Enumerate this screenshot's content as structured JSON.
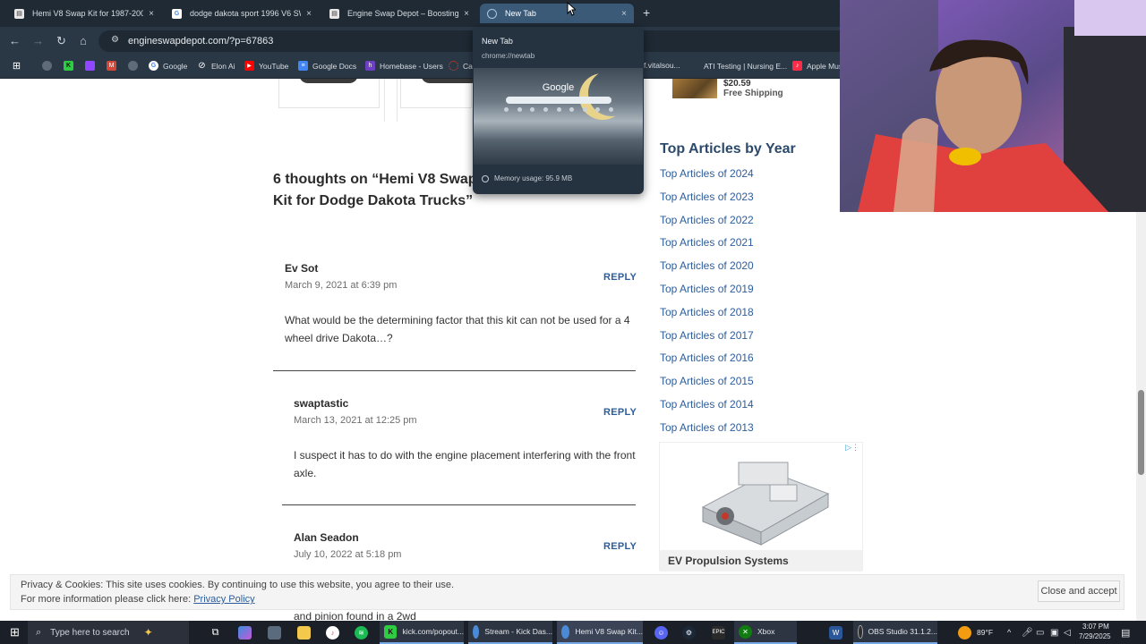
{
  "browser": {
    "tabs": [
      {
        "label": "Hemi V8 Swap Kit for 1987-2004 D",
        "favicon": "page-icon",
        "color": "#e8e8e8",
        "active": false
      },
      {
        "label": "dodge dakota sport 1996 V6 SWA",
        "favicon": "google-icon",
        "color": "#4285f4",
        "active": false
      },
      {
        "label": "Engine Swap Depot – Boosting Pe",
        "favicon": "page-icon",
        "color": "#e8e8e8",
        "active": false
      },
      {
        "label": "New Tab",
        "favicon": "chrome-icon",
        "color": "#7aa7d6",
        "active": true
      }
    ],
    "new_tab_glyph": "+",
    "close_glyph": "×",
    "url": "engineswapdepot.com/?p=67863",
    "bookmarks": [
      {
        "label": "",
        "icon": "apps-grid-icon",
        "color": "#2a3846"
      },
      {
        "label": "",
        "icon": "globe-icon",
        "color": "#5f6b77"
      },
      {
        "label": "",
        "icon": "kick-icon",
        "color": "#2ecc40"
      },
      {
        "label": "",
        "icon": "twitch-icon",
        "color": "#9146ff"
      },
      {
        "label": "",
        "icon": "gmail-icon",
        "color": "#d44638"
      },
      {
        "label": "",
        "icon": "globe-icon",
        "color": "#5f6b77"
      },
      {
        "label": "Google",
        "icon": "google-icon",
        "color": "#4285f4"
      },
      {
        "label": "Elon Ai",
        "icon": "grok-icon",
        "color": "#444"
      },
      {
        "label": "YouTube",
        "icon": "youtube-icon",
        "color": "#ff0000"
      },
      {
        "label": "Google Docs",
        "icon": "docs-icon",
        "color": "#4285f4"
      },
      {
        "label": "Homebase - Users",
        "icon": "homebase-icon",
        "color": "#6c3fc5"
      },
      {
        "label": "Ca",
        "icon": "canvas-icon",
        "color": "#e13b2b"
      },
      {
        "label": "f.vitalsou...",
        "icon": "",
        "color": "#2a3846"
      },
      {
        "label": "ATI Testing | Nursing E...",
        "icon": "ati-icon",
        "color": "#2a3846"
      },
      {
        "label": "Apple Mus",
        "icon": "apple-music-icon",
        "color": "#fa2d48"
      }
    ]
  },
  "hover_card": {
    "title": "New Tab",
    "url": "chrome://newtab",
    "preview_logo": "Google",
    "memory": "Memory usage: 95.9 MB"
  },
  "article": {
    "comments_title": "6 thoughts on “Hemi V8 Swap Kit for Dodge Dakota Trucks”",
    "reply_label": "REPLY",
    "comments": [
      {
        "author": "Ev Sot",
        "date": "March 9, 2021 at 6:39 pm",
        "text": "What would be the determining factor that this kit can not be used for a 4 wheel drive Dakota…?"
      },
      {
        "author": "swaptastic",
        "date": "March 13, 2021 at 12:25 pm",
        "text": "I suspect it has to do with the engine placement interfering with the front axle."
      },
      {
        "author": "Alan Seadon",
        "date": "July 10, 2022 at 5:18 pm",
        "text": "and pinion found in a 2wd"
      }
    ]
  },
  "sidebar": {
    "product_price": "$20.59",
    "product_shipping": "Free Shipping",
    "heading": "Top Articles by Year",
    "year_links": [
      "Top Articles of 2024",
      "Top Articles of 2023",
      "Top Articles of 2022",
      "Top Articles of 2021",
      "Top Articles of 2020",
      "Top Articles of 2019",
      "Top Articles of 2018",
      "Top Articles of 2017",
      "Top Articles of 2016",
      "Top Articles of 2015",
      "Top Articles of 2014",
      "Top Articles of 2013"
    ],
    "ad_caption": "EV Propulsion Systems"
  },
  "cookie_notice": {
    "line1": "Privacy & Cookies: This site uses cookies. By continuing to use this website, you agree to their use.",
    "line2_prefix": "For more information please click here: ",
    "line2_link": "Privacy Policy",
    "button": "Close and accept"
  },
  "taskbar": {
    "search_placeholder": "Type here to search",
    "apps": [
      {
        "label": "kick.com/popout...",
        "icon": "kick-icon",
        "color": "#2ecc40"
      },
      {
        "label": "Stream - Kick Das...",
        "icon": "chrome-icon",
        "color": "#4a8ad6"
      },
      {
        "label": "Hemi V8 Swap Kit...",
        "icon": "chrome-icon",
        "color": "#4a8ad6"
      },
      {
        "label": "Xbox",
        "icon": "xbox-icon",
        "color": "#107c10"
      },
      {
        "label": "OBS Studio 31.1.2...",
        "icon": "obs-icon",
        "color": "#302e31"
      }
    ],
    "weather": "89°F",
    "time": "3:07 PM",
    "date": "7/29/2025"
  }
}
